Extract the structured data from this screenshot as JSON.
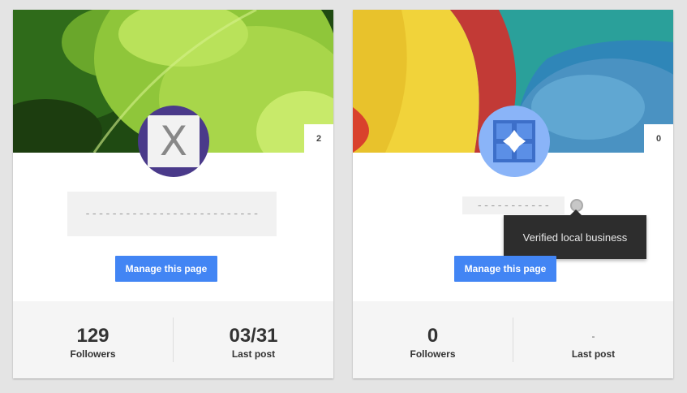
{
  "cards": [
    {
      "badge_count": "2",
      "avatar_letter": "X",
      "name_placeholder": "--------------------------",
      "manage_label": "Manage this page",
      "followers_value": "129",
      "followers_label": "Followers",
      "last_post_value": "03/31",
      "last_post_label": "Last post"
    },
    {
      "badge_count": "0",
      "name_placeholder": "-----------",
      "verified_tooltip": "Verified local business",
      "manage_label": "Manage this page",
      "followers_value": "0",
      "followers_label": "Followers",
      "last_post_value": "-",
      "last_post_label": "Last post"
    }
  ],
  "colors": {
    "accent": "#4285f4",
    "tooltip_bg": "#2d2d2d",
    "avatar_purple": "#4a3a8a",
    "avatar_blue": "#8ab4f8"
  }
}
